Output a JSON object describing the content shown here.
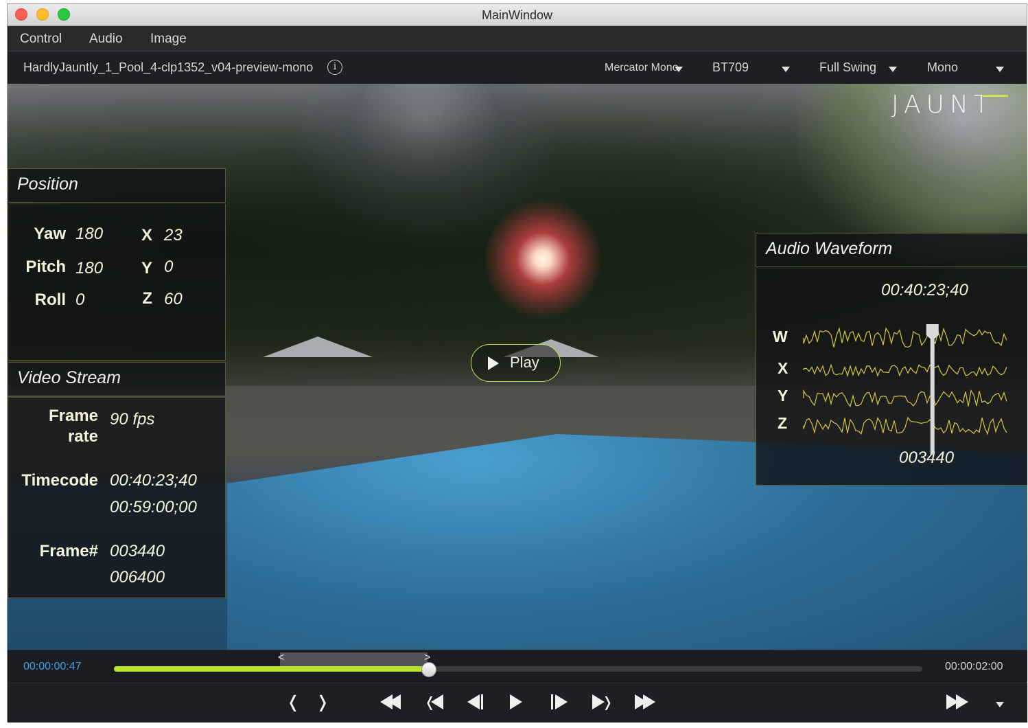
{
  "window": {
    "title": "MainWindow"
  },
  "menu": {
    "items": [
      "Control",
      "Audio",
      "Image"
    ]
  },
  "toolbar": {
    "filename": "HardlyJauntly_1_Pool_4-clp1352_v04-preview-mono",
    "info_icon": "info-icon",
    "projection": "Mercator Mono",
    "colorspace": "BT709",
    "range": "Full Swing",
    "channel_mode": "Mono"
  },
  "overlay": {
    "logo": "JAUNT",
    "play_label": "Play"
  },
  "position_panel": {
    "title": "Position",
    "yaw_label": "Yaw",
    "yaw_value": "180",
    "pitch_label": "Pitch",
    "pitch_value": "180",
    "roll_label": "Roll",
    "roll_value": "0",
    "x_label": "X",
    "x_value": "23",
    "y_label": "Y",
    "y_value": "0",
    "z_label": "Z",
    "z_value": "60"
  },
  "video_panel": {
    "title": "Video Stream",
    "framerate_label_1": "Frame",
    "framerate_label_2": "rate",
    "framerate_value": "90 fps",
    "timecode_label": "Timecode",
    "timecode_current": "00:40:23;40",
    "timecode_total": "00:59:00;00",
    "frame_label": "Frame#",
    "frame_current": "003440",
    "frame_total": "006400"
  },
  "audio_panel": {
    "title": "Audio Waveform",
    "timecode": "00:40:23;40",
    "frame": "003440",
    "channels": [
      "W",
      "X",
      "Y",
      "Z"
    ],
    "waveform_color": "#d9c843",
    "playhead_fraction": 0.63
  },
  "timeline": {
    "current_time": "00:00:00:47",
    "end_time": "00:00:02:00",
    "progress": 0.39,
    "in_marker": "<",
    "out_marker": ">",
    "accent_color": "#b8e52c"
  },
  "transport": {
    "icons": [
      "mark-in-icon",
      "mark-out-icon",
      "rewind-icon",
      "go-to-in-icon",
      "step-back-icon",
      "play-icon",
      "step-forward-icon",
      "go-to-out-icon",
      "fast-forward-icon",
      "skip-end-icon",
      "more-chevron-icon"
    ]
  }
}
